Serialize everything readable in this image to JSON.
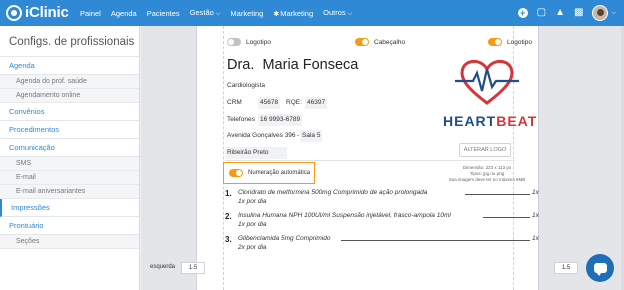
{
  "app": {
    "brand": "iClinic"
  },
  "nav": {
    "items": [
      {
        "label": "Painel",
        "caret": false
      },
      {
        "label": "Agenda",
        "caret": false
      },
      {
        "label": "Pacientes",
        "caret": false
      },
      {
        "label": "Gestão",
        "caret": true
      },
      {
        "label": "Marketing",
        "caret": false
      },
      {
        "label": "Marketing",
        "caret": false,
        "star": true
      },
      {
        "label": "Outros",
        "caret": true
      }
    ]
  },
  "sidebar": {
    "title": "Configs. de profissionais",
    "sections": [
      {
        "label": "Agenda",
        "subs": [
          "Agenda do prof. saúde",
          "Agendamento online"
        ]
      },
      {
        "label": "Convênios",
        "subs": []
      },
      {
        "label": "Procedimentos",
        "subs": []
      },
      {
        "label": "Comunicação",
        "subs": [
          "SMS",
          "E-mail",
          "E-mail aniversariantes"
        ]
      },
      {
        "label": "Impressões",
        "subs": [],
        "active": true
      },
      {
        "label": "Prontuário",
        "subs": [
          "Seções"
        ]
      }
    ]
  },
  "toggles": {
    "logo_left": {
      "label": "Logotipo",
      "on": false
    },
    "header": {
      "label": "Cabeçalho",
      "on": true
    },
    "logo_right": {
      "label": "Logotipo",
      "on": true
    }
  },
  "doctor": {
    "prefix": "Dra.",
    "name": "Maria Fonseca",
    "specialty": "Cardiologista",
    "crm_label": "CRM",
    "crm": "45678",
    "rqe_label": "RQE:",
    "rqe": "46397",
    "phone_label": "Telefones",
    "phone": "16 9993-6789",
    "address": "Avenida Gonçalves 396",
    "address_extra": "Sala 5",
    "city": "Ribeirão Preto"
  },
  "logo": {
    "brand_part1": "HEART",
    "brand_part2": "BEAT",
    "button": "ALTERAR LOGO",
    "info_line1": "Dimensão: 223 x 113 px",
    "info_line2": "Tipos: jpg ou png",
    "info_line3": "Sua imagem deve ter no máximo 5MB"
  },
  "numbering": {
    "label": "Numeração automática",
    "on": true
  },
  "prescriptions": [
    {
      "n": "1.",
      "name": "Cloridrato de metformina 500mg Comprimido de ação prolongada",
      "qty": "1x",
      "dose": "1x por dia"
    },
    {
      "n": "2.",
      "name": "Insulina Humana NPH 100UI/ml Suspensão injetável, frasco-ampola 10ml",
      "qty": "1x",
      "dose": "1x por dia"
    },
    {
      "n": "3.",
      "name": "Glibenclamida 5mg Comprimido",
      "qty": "1x",
      "dose": "2x por dia"
    }
  ],
  "margins": {
    "left_label": "esquerda",
    "left_value": "1.5",
    "right_value": "1.5"
  },
  "colors": {
    "brand_blue": "#2f89d4",
    "accent_orange": "#f39c12",
    "heart_red": "#d8353b",
    "heart_blue": "#1e4f8a"
  }
}
